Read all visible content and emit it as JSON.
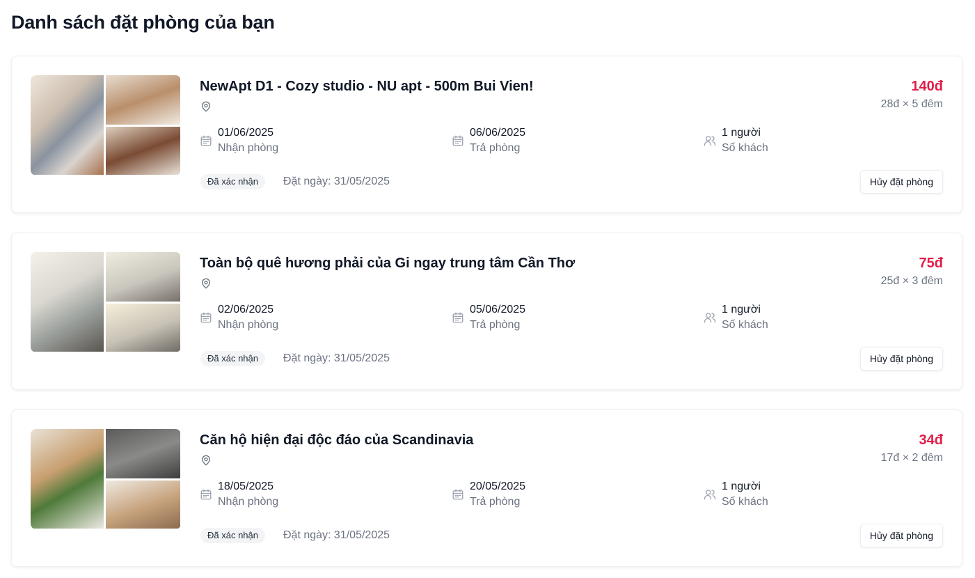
{
  "page": {
    "title": "Danh sách đặt phòng của bạn"
  },
  "labels": {
    "checkin": "Nhận phòng",
    "checkout": "Trả phòng",
    "guests": "Số khách",
    "cancel": "Hủy đặt phòng"
  },
  "bookings": [
    {
      "title": "NewApt D1 - Cozy studio - NU apt - 500m Bui Vien!",
      "checkin": "01/06/2025",
      "checkout": "06/06/2025",
      "guests": "1 người",
      "status": "Đã xác nhận",
      "booked_on": "Đặt ngày: 31/05/2025",
      "price": "140đ",
      "price_detail": "28đ × 5 đêm"
    },
    {
      "title": "Toàn bộ quê hương phải của Gi ngay trung tâm Cần Thơ",
      "checkin": "02/06/2025",
      "checkout": "05/06/2025",
      "guests": "1 người",
      "status": "Đã xác nhận",
      "booked_on": "Đặt ngày: 31/05/2025",
      "price": "75đ",
      "price_detail": "25đ × 3 đêm"
    },
    {
      "title": "Căn hộ hiện đại độc đáo của Scandinavia",
      "checkin": "18/05/2025",
      "checkout": "20/05/2025",
      "guests": "1 người",
      "status": "Đã xác nhận",
      "booked_on": "Đặt ngày: 31/05/2025",
      "price": "34đ",
      "price_detail": "17đ × 2 đêm"
    }
  ],
  "colors": {
    "accent_price": "#e11d48",
    "text_primary": "#111827",
    "text_muted": "#6b7280",
    "badge_bg": "#f3f4f6"
  },
  "icons": {
    "location": "map-pin-icon",
    "date": "calendar-icon",
    "guests": "users-icon"
  }
}
